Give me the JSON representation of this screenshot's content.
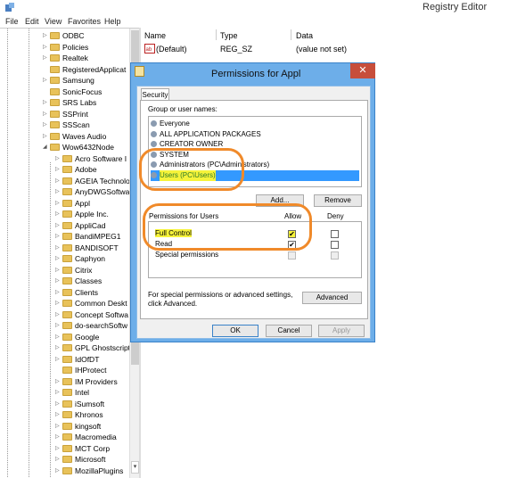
{
  "app": {
    "title": "Registry Editor"
  },
  "menu": [
    "File",
    "Edit",
    "View",
    "Favorites",
    "Help"
  ],
  "tree": {
    "items": [
      {
        "label": "ODBC",
        "level": 0,
        "expander": "▷"
      },
      {
        "label": "Policies",
        "level": 0,
        "expander": "▷"
      },
      {
        "label": "Realtek",
        "level": 0,
        "expander": "▷"
      },
      {
        "label": "RegisteredApplicat",
        "level": 0,
        "expander": ""
      },
      {
        "label": "Samsung",
        "level": 0,
        "expander": "▷"
      },
      {
        "label": "SonicFocus",
        "level": 0,
        "expander": ""
      },
      {
        "label": "SRS Labs",
        "level": 0,
        "expander": "▷"
      },
      {
        "label": "SSPrint",
        "level": 0,
        "expander": "▷"
      },
      {
        "label": "SSScan",
        "level": 0,
        "expander": "▷"
      },
      {
        "label": "Waves Audio",
        "level": 0,
        "expander": "▷"
      },
      {
        "label": "Wow6432Node",
        "level": 0,
        "expander": "◢"
      },
      {
        "label": "Acro Software I",
        "level": 1,
        "expander": "▷"
      },
      {
        "label": "Adobe",
        "level": 1,
        "expander": "▷"
      },
      {
        "label": "AGEIA Technolo",
        "level": 1,
        "expander": "▷"
      },
      {
        "label": "AnyDWGSoftwa",
        "level": 1,
        "expander": "▷"
      },
      {
        "label": "Appl",
        "level": 1,
        "expander": "▷"
      },
      {
        "label": "Apple Inc.",
        "level": 1,
        "expander": "▷"
      },
      {
        "label": "AppliCad",
        "level": 1,
        "expander": "▷"
      },
      {
        "label": "BandiMPEG1",
        "level": 1,
        "expander": "▷"
      },
      {
        "label": "BANDISOFT",
        "level": 1,
        "expander": "▷"
      },
      {
        "label": "Caphyon",
        "level": 1,
        "expander": "▷"
      },
      {
        "label": "Citrix",
        "level": 1,
        "expander": "▷"
      },
      {
        "label": "Classes",
        "level": 1,
        "expander": "▷"
      },
      {
        "label": "Clients",
        "level": 1,
        "expander": "▷"
      },
      {
        "label": "Common Deskt",
        "level": 1,
        "expander": "▷"
      },
      {
        "label": "Concept Softwa",
        "level": 1,
        "expander": "▷"
      },
      {
        "label": "do-searchSoftw",
        "level": 1,
        "expander": "▷"
      },
      {
        "label": "Google",
        "level": 1,
        "expander": "▷"
      },
      {
        "label": "GPL Ghostscript",
        "level": 1,
        "expander": "▷"
      },
      {
        "label": "IdOfDT",
        "level": 1,
        "expander": "▷"
      },
      {
        "label": "IHProtect",
        "level": 1,
        "expander": ""
      },
      {
        "label": "IM Providers",
        "level": 1,
        "expander": "▷"
      },
      {
        "label": "Intel",
        "level": 1,
        "expander": "▷"
      },
      {
        "label": "iSumsoft",
        "level": 1,
        "expander": "▷"
      },
      {
        "label": "Khronos",
        "level": 1,
        "expander": "▷"
      },
      {
        "label": "kingsoft",
        "level": 1,
        "expander": "▷"
      },
      {
        "label": "Macromedia",
        "level": 1,
        "expander": "▷"
      },
      {
        "label": "MCT Corp",
        "level": 1,
        "expander": "▷"
      },
      {
        "label": "Microsoft",
        "level": 1,
        "expander": "▷"
      },
      {
        "label": "MozillaPlugins",
        "level": 1,
        "expander": "▷"
      }
    ]
  },
  "values_pane": {
    "headers": {
      "name": "Name",
      "type": "Type",
      "data": "Data"
    },
    "rows": [
      {
        "name": "(Default)",
        "type": "REG_SZ",
        "data": "(value not set)",
        "icon": "reg-string-icon"
      }
    ]
  },
  "dialog": {
    "title": "Permissions for Appl",
    "close_label": "✕",
    "tab": "Security",
    "group_label": "Group or user names:",
    "users": [
      {
        "label": "Everyone",
        "selected": false
      },
      {
        "label": "ALL APPLICATION PACKAGES",
        "selected": false
      },
      {
        "label": "CREATOR OWNER",
        "selected": false
      },
      {
        "label": "SYSTEM",
        "selected": false
      },
      {
        "label": "Administrators (PC\\Administrators)",
        "selected": false
      },
      {
        "label": "Users (PC\\Users)",
        "selected": true
      }
    ],
    "add_label": "Add...",
    "remove_label": "Remove",
    "perm_header": "Permissions for Users",
    "allow_label": "Allow",
    "deny_label": "Deny",
    "permissions": [
      {
        "label": "Full Control",
        "allow": true,
        "deny": false,
        "highlight": true
      },
      {
        "label": "Read",
        "allow": true,
        "deny": false,
        "highlight": false
      },
      {
        "label": "Special permissions",
        "allow": false,
        "deny": false,
        "highlight": false
      }
    ],
    "advanced_note": "For special permissions or advanced settings, click Advanced.",
    "advanced_label": "Advanced",
    "ok_label": "OK",
    "cancel_label": "Cancel",
    "apply_label": "Apply"
  }
}
